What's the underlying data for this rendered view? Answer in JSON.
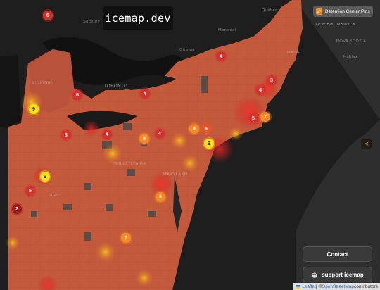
{
  "app": {
    "title": "icemap.dev"
  },
  "layer_toggle": {
    "label": "Detention Center Pins",
    "checked": true
  },
  "share": {
    "icon": "share-icon"
  },
  "buttons": {
    "contact": "Contact",
    "support": "support icemap",
    "support_icon": "coffee-cup-icon"
  },
  "attribution": {
    "leaflet": "Leaflet",
    "sep": " | © ",
    "osm": "OpenStreetMap",
    "suffix": " contributors"
  },
  "map_labels": {
    "toronto": "TORONTO",
    "michigan": "MICHIGAN",
    "sudbury": "Sudbury",
    "ottawa": "Ottawa",
    "montreal": "Montréal",
    "maine": "MAINE",
    "new_brunswick": "NEW BRUNSWICK",
    "nova_scotia": "NOVA SCOTIA",
    "halifax": "Halifax",
    "quebec": "Québec",
    "maryland": "MARYLAND",
    "pennsylvania": "PENNSYLVANIA",
    "ohio": "OHIO"
  },
  "colors": {
    "pin_red": "#d4322f",
    "pin_red_orange": "#e0572a",
    "pin_orange": "#f58a25",
    "pin_yellow": "#f7e01a",
    "pin_dark_red": "#9e1b1b",
    "accent": "#f58a25"
  },
  "pins": [
    {
      "count": "6",
      "color": "c1"
    },
    {
      "count": "4",
      "color": "c1"
    },
    {
      "count": "3",
      "color": "c1"
    },
    {
      "count": "4",
      "color": "c1"
    },
    {
      "count": "6",
      "color": "c1"
    },
    {
      "count": "4",
      "color": "c1"
    },
    {
      "count": "9",
      "color": "c4"
    },
    {
      "count": "5",
      "color": "c1"
    },
    {
      "count": "7",
      "color": "c3"
    },
    {
      "count": "3",
      "color": "c1"
    },
    {
      "count": "4",
      "color": "c1"
    },
    {
      "count": "8",
      "color": "c3"
    },
    {
      "count": "4",
      "color": "c1"
    },
    {
      "count": "8",
      "color": "c3"
    },
    {
      "count": "6",
      "color": "c2"
    },
    {
      "count": "9",
      "color": "c4"
    },
    {
      "count": "9",
      "color": "c4"
    },
    {
      "count": "5",
      "color": "c1"
    },
    {
      "count": "2",
      "color": "c5"
    },
    {
      "count": "8",
      "color": "c3"
    },
    {
      "count": "7",
      "color": "c3"
    }
  ]
}
